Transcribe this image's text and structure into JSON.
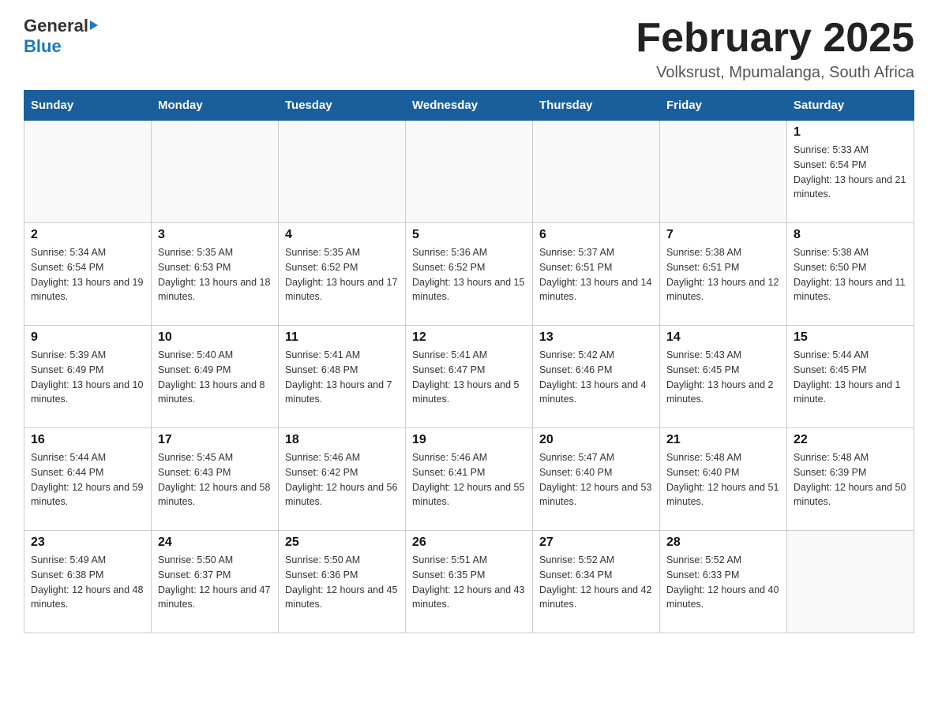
{
  "header": {
    "logo_general": "General",
    "logo_blue": "Blue",
    "month_title": "February 2025",
    "location": "Volksrust, Mpumalanga, South Africa"
  },
  "days_of_week": [
    "Sunday",
    "Monday",
    "Tuesday",
    "Wednesday",
    "Thursday",
    "Friday",
    "Saturday"
  ],
  "weeks": [
    [
      {
        "day": "",
        "info": ""
      },
      {
        "day": "",
        "info": ""
      },
      {
        "day": "",
        "info": ""
      },
      {
        "day": "",
        "info": ""
      },
      {
        "day": "",
        "info": ""
      },
      {
        "day": "",
        "info": ""
      },
      {
        "day": "1",
        "info": "Sunrise: 5:33 AM\nSunset: 6:54 PM\nDaylight: 13 hours and 21 minutes."
      }
    ],
    [
      {
        "day": "2",
        "info": "Sunrise: 5:34 AM\nSunset: 6:54 PM\nDaylight: 13 hours and 19 minutes."
      },
      {
        "day": "3",
        "info": "Sunrise: 5:35 AM\nSunset: 6:53 PM\nDaylight: 13 hours and 18 minutes."
      },
      {
        "day": "4",
        "info": "Sunrise: 5:35 AM\nSunset: 6:52 PM\nDaylight: 13 hours and 17 minutes."
      },
      {
        "day": "5",
        "info": "Sunrise: 5:36 AM\nSunset: 6:52 PM\nDaylight: 13 hours and 15 minutes."
      },
      {
        "day": "6",
        "info": "Sunrise: 5:37 AM\nSunset: 6:51 PM\nDaylight: 13 hours and 14 minutes."
      },
      {
        "day": "7",
        "info": "Sunrise: 5:38 AM\nSunset: 6:51 PM\nDaylight: 13 hours and 12 minutes."
      },
      {
        "day": "8",
        "info": "Sunrise: 5:38 AM\nSunset: 6:50 PM\nDaylight: 13 hours and 11 minutes."
      }
    ],
    [
      {
        "day": "9",
        "info": "Sunrise: 5:39 AM\nSunset: 6:49 PM\nDaylight: 13 hours and 10 minutes."
      },
      {
        "day": "10",
        "info": "Sunrise: 5:40 AM\nSunset: 6:49 PM\nDaylight: 13 hours and 8 minutes."
      },
      {
        "day": "11",
        "info": "Sunrise: 5:41 AM\nSunset: 6:48 PM\nDaylight: 13 hours and 7 minutes."
      },
      {
        "day": "12",
        "info": "Sunrise: 5:41 AM\nSunset: 6:47 PM\nDaylight: 13 hours and 5 minutes."
      },
      {
        "day": "13",
        "info": "Sunrise: 5:42 AM\nSunset: 6:46 PM\nDaylight: 13 hours and 4 minutes."
      },
      {
        "day": "14",
        "info": "Sunrise: 5:43 AM\nSunset: 6:45 PM\nDaylight: 13 hours and 2 minutes."
      },
      {
        "day": "15",
        "info": "Sunrise: 5:44 AM\nSunset: 6:45 PM\nDaylight: 13 hours and 1 minute."
      }
    ],
    [
      {
        "day": "16",
        "info": "Sunrise: 5:44 AM\nSunset: 6:44 PM\nDaylight: 12 hours and 59 minutes."
      },
      {
        "day": "17",
        "info": "Sunrise: 5:45 AM\nSunset: 6:43 PM\nDaylight: 12 hours and 58 minutes."
      },
      {
        "day": "18",
        "info": "Sunrise: 5:46 AM\nSunset: 6:42 PM\nDaylight: 12 hours and 56 minutes."
      },
      {
        "day": "19",
        "info": "Sunrise: 5:46 AM\nSunset: 6:41 PM\nDaylight: 12 hours and 55 minutes."
      },
      {
        "day": "20",
        "info": "Sunrise: 5:47 AM\nSunset: 6:40 PM\nDaylight: 12 hours and 53 minutes."
      },
      {
        "day": "21",
        "info": "Sunrise: 5:48 AM\nSunset: 6:40 PM\nDaylight: 12 hours and 51 minutes."
      },
      {
        "day": "22",
        "info": "Sunrise: 5:48 AM\nSunset: 6:39 PM\nDaylight: 12 hours and 50 minutes."
      }
    ],
    [
      {
        "day": "23",
        "info": "Sunrise: 5:49 AM\nSunset: 6:38 PM\nDaylight: 12 hours and 48 minutes."
      },
      {
        "day": "24",
        "info": "Sunrise: 5:50 AM\nSunset: 6:37 PM\nDaylight: 12 hours and 47 minutes."
      },
      {
        "day": "25",
        "info": "Sunrise: 5:50 AM\nSunset: 6:36 PM\nDaylight: 12 hours and 45 minutes."
      },
      {
        "day": "26",
        "info": "Sunrise: 5:51 AM\nSunset: 6:35 PM\nDaylight: 12 hours and 43 minutes."
      },
      {
        "day": "27",
        "info": "Sunrise: 5:52 AM\nSunset: 6:34 PM\nDaylight: 12 hours and 42 minutes."
      },
      {
        "day": "28",
        "info": "Sunrise: 5:52 AM\nSunset: 6:33 PM\nDaylight: 12 hours and 40 minutes."
      },
      {
        "day": "",
        "info": ""
      }
    ]
  ]
}
